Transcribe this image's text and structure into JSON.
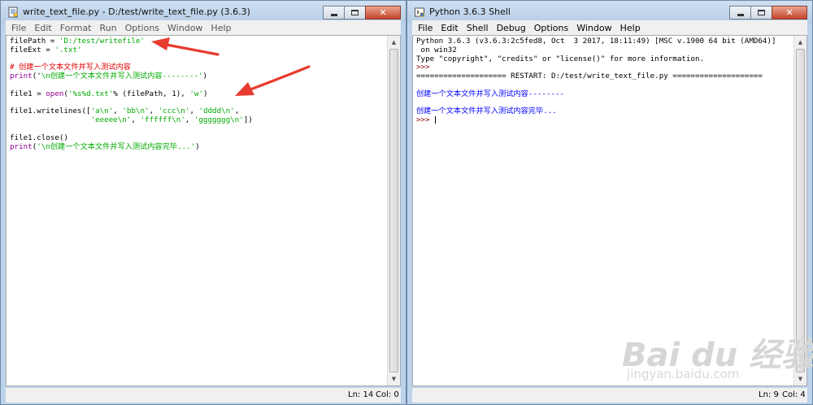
{
  "editor": {
    "title": "write_text_file.py - D:/test/write_text_file.py (3.6.3)",
    "icon": "idle-editor-icon",
    "menu": [
      "File",
      "Edit",
      "Format",
      "Run",
      "Options",
      "Window",
      "Help"
    ],
    "code": {
      "l1": {
        "a": "filePath = ",
        "b": "'D:/test/writefile'"
      },
      "l2": {
        "a": "fileExt = ",
        "b": "'.txt'"
      },
      "l4": {
        "a": "# 创建一个文本文件并写入测试内容"
      },
      "l5": {
        "a": "print",
        "b": "('",
        "c": "\\n创建一个文本文件并写入测试内容--------'",
        "d": ")"
      },
      "l7": {
        "a": "file1 = ",
        "b": "open",
        "c": "(",
        "d": "'%s%d.txt'",
        "e": "% (filePath, 1), ",
        "f": "'w'",
        "g": ")"
      },
      "l9": {
        "a": "file1.writelines([",
        "b": "'a\\n'",
        "c": ", ",
        "d": "'bb\\n'",
        "e": ", ",
        "f": "'ccc\\n'",
        "g": ", ",
        "h": "'dddd\\n'",
        "i": ","
      },
      "l10": {
        "a": "                  ",
        "b": "'eeeee\\n'",
        "c": ", ",
        "d": "'ffffff\\n'",
        "e": ", ",
        "f": "'ggggggg\\n'",
        "g": "])"
      },
      "l12": {
        "a": "file1.close()"
      },
      "l13": {
        "a": "print",
        "b": "(",
        "c": "'\\n创建一个文本文件并写入测试内容完毕...'",
        "d": ")"
      }
    },
    "status": {
      "ln": "Ln: 14",
      "col": "Col: 0"
    }
  },
  "shell": {
    "title": "Python 3.6.3 Shell",
    "icon": "python-shell-icon",
    "menu": [
      "File",
      "Edit",
      "Shell",
      "Debug",
      "Options",
      "Window",
      "Help"
    ],
    "lines": {
      "banner1": "Python 3.6.3 (v3.6.3:2c5fed8, Oct  3 2017, 18:11:49) [MSC v.1900 64 bit (AMD64)]",
      "banner2": " on win32",
      "banner3": "Type \"copyright\", \"credits\" or \"license()\" for more information.",
      "prompt1": ">>> ",
      "restart": "==================== RESTART: D:/test/write_text_file.py ====================",
      "out1": "创建一个文本文件并写入测试内容--------",
      "out2": "创建一个文本文件并写入测试内容完毕...",
      "prompt2": ">>> "
    },
    "status": {
      "ln": "Ln: 9",
      "col": "Col: 4"
    }
  },
  "watermark": {
    "logo": "Bai du 经验",
    "url": "jingyan.baidu.com"
  },
  "colors": {
    "string": "#00aa00",
    "builtin": "#900090",
    "comment": "#dd0000",
    "output": "#0000ff",
    "annotation_arrow": "#e83c2f"
  }
}
